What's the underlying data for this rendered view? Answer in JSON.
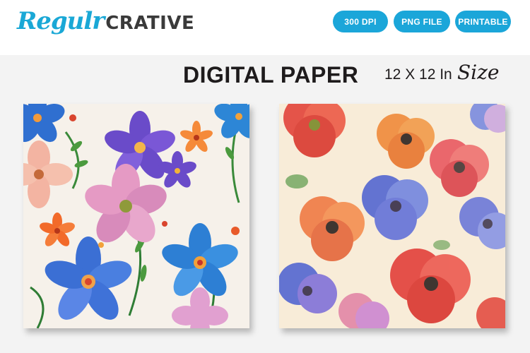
{
  "brand": {
    "script": "Regulr",
    "bold": "CRATIVE"
  },
  "badges": [
    "300 DPI",
    "PNG FILE",
    "PRINTABLE"
  ],
  "headline": "DIGITAL PAPER",
  "size": {
    "dimensions": "12 X 12 In",
    "script": "Size"
  },
  "colors": {
    "accent": "#1ba6d9",
    "text": "#1e1b1c",
    "background": "#f3f3f3"
  },
  "papers": [
    {
      "pattern": "floral-wildflower-pattern"
    },
    {
      "pattern": "watercolor-poppy-pattern"
    }
  ]
}
